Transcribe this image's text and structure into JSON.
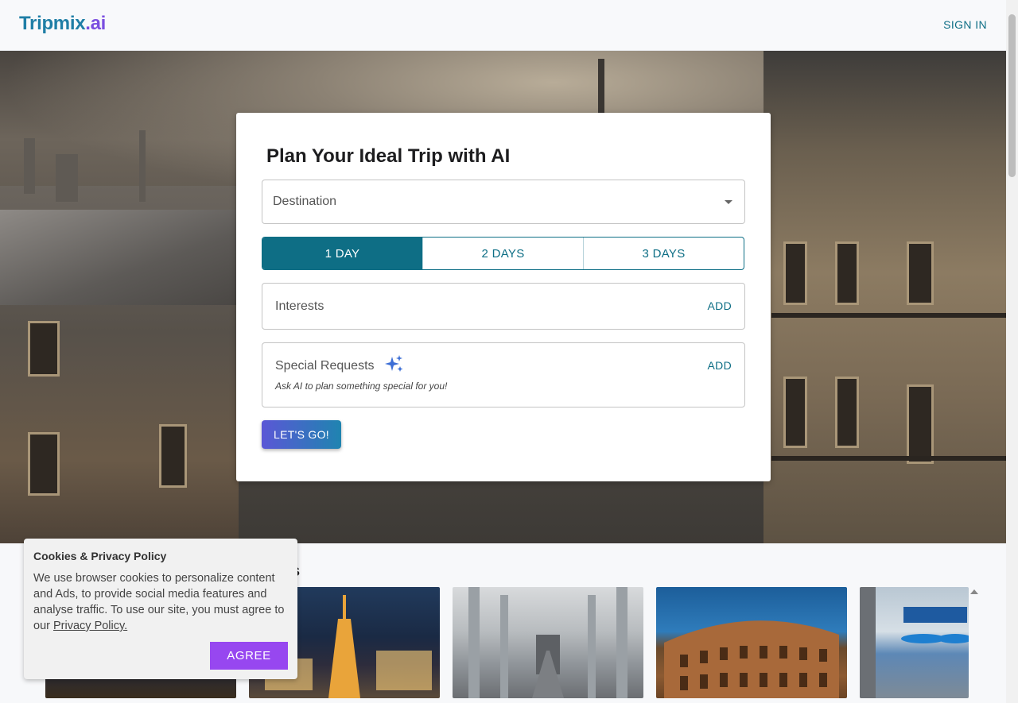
{
  "header": {
    "logo_part1": "Tripmix",
    "logo_part2": ".ai",
    "signin_label": "SIGN IN"
  },
  "planner": {
    "title": "Plan Your Ideal Trip with AI",
    "title_icon": "",
    "destination_label": "Destination",
    "day_options": [
      "1 DAY",
      "2 DAYS",
      "3 DAYS"
    ],
    "selected_day_index": 0,
    "interests_label": "Interests",
    "interests_add": "ADD",
    "special_label": "Special Requests",
    "special_hint": "Ask AI to plan something special for you!",
    "special_add": "ADD",
    "go_label": "LET'S GO!"
  },
  "section": {
    "title_visible_fragment": "s"
  },
  "cookie": {
    "title": "Cookies & Privacy Policy",
    "body": "We use browser cookies to personalize content and Ads, to provide social media features and analyse traffic. To use our site, you must agree to our ",
    "policy_link": "Privacy Policy.",
    "agree_label": "AGREE"
  },
  "colors": {
    "accent": "#0e6e85",
    "brand_purple": "#9747f0"
  }
}
